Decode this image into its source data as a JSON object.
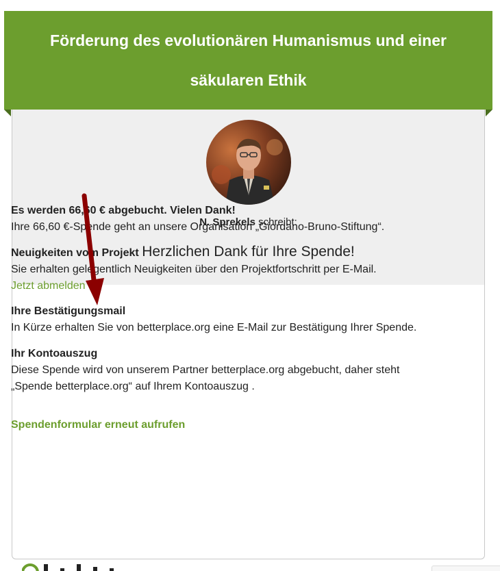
{
  "header": {
    "title_line1": "Förderung des evolutionären Humanismus und einer",
    "title_line2": "säkularen Ethik"
  },
  "author": {
    "name": "N. Sprekels",
    "suffix": " schreibt:"
  },
  "thanks_message": "Herzlichen Dank für Ihre Spende!",
  "sections": [
    {
      "heading": "Es werden 66,60 € abgebucht. Vielen Dank!",
      "text": "Ihre 66,60 €-Spende geht an unsere Organisation „Giordano-Bruno-Stiftung“."
    },
    {
      "heading": "Neuigkeiten vom Projekt",
      "text": "Sie erhalten gelegentlich Neuigkeiten über den Projektfortschritt per E-Mail.",
      "link": "Jetzt abmelden"
    },
    {
      "heading": "Ihre Bestätigungsmail",
      "text": "In Kürze erhalten Sie von betterplace.org eine E-Mail zur Bestätigung Ihrer Spende."
    },
    {
      "heading": "Ihr Kontoauszug",
      "text_line1": "Diese Spende wird von unserem Partner betterplace.org abgebucht, daher steht",
      "text_line2": "„Spende betterplace.org“ auf Ihrem Kontoauszug ."
    }
  ],
  "reopen_link": "Spendenformular erneut aufrufen",
  "colors": {
    "brand_green": "#6c9e2e",
    "arrow_red": "#8b0000",
    "panel_gray": "#efefef"
  },
  "icons": {
    "arrow": "red-down-arrow",
    "logo": "betterplace-logo"
  }
}
